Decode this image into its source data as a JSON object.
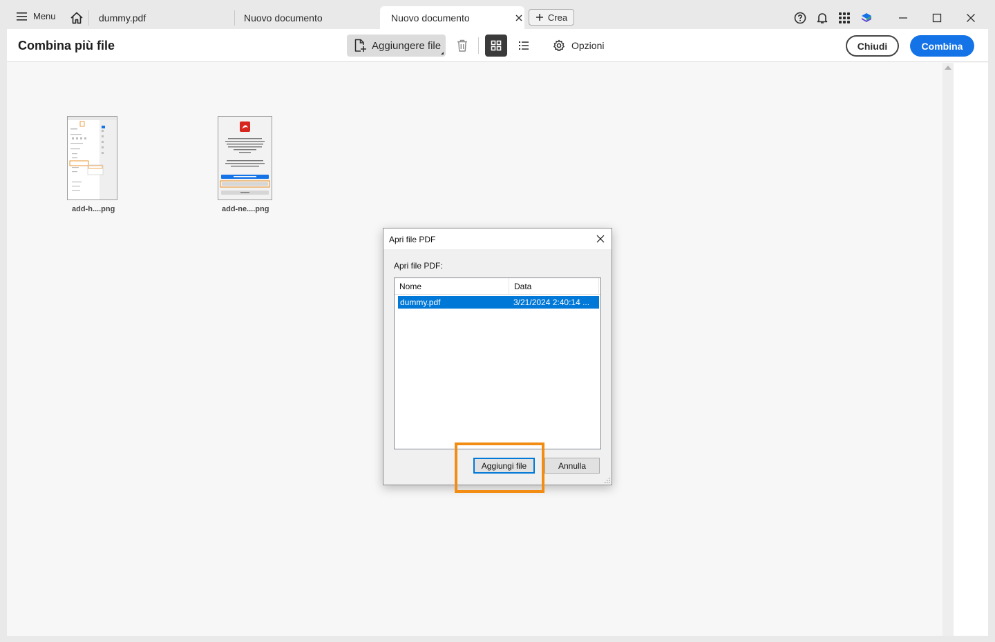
{
  "tabbar": {
    "menu_label": "Menu",
    "tabs": [
      {
        "label": "dummy.pdf"
      },
      {
        "label": "Nuovo documento"
      },
      {
        "label": "Nuovo documento"
      }
    ],
    "crea_label": "Crea"
  },
  "toolbar": {
    "title": "Combina più file",
    "add_files_label": "Aggiungere file",
    "options_label": "Opzioni",
    "close_label": "Chiudi",
    "combine_label": "Combina"
  },
  "colors": {
    "accent": "#1473e6",
    "selection": "#0078d7",
    "highlight": "#f28c13"
  },
  "files": [
    {
      "label": "add-h....png"
    },
    {
      "label": "add-ne....png"
    }
  ],
  "dialog": {
    "title": "Apri file PDF",
    "label": "Apri file PDF:",
    "columns": [
      "Nome",
      "Data"
    ],
    "rows": [
      {
        "name": "dummy.pdf",
        "date": "3/21/2024 2:40:14 ..."
      }
    ],
    "add_button": "Aggiungi file",
    "cancel_button": "Annulla"
  }
}
